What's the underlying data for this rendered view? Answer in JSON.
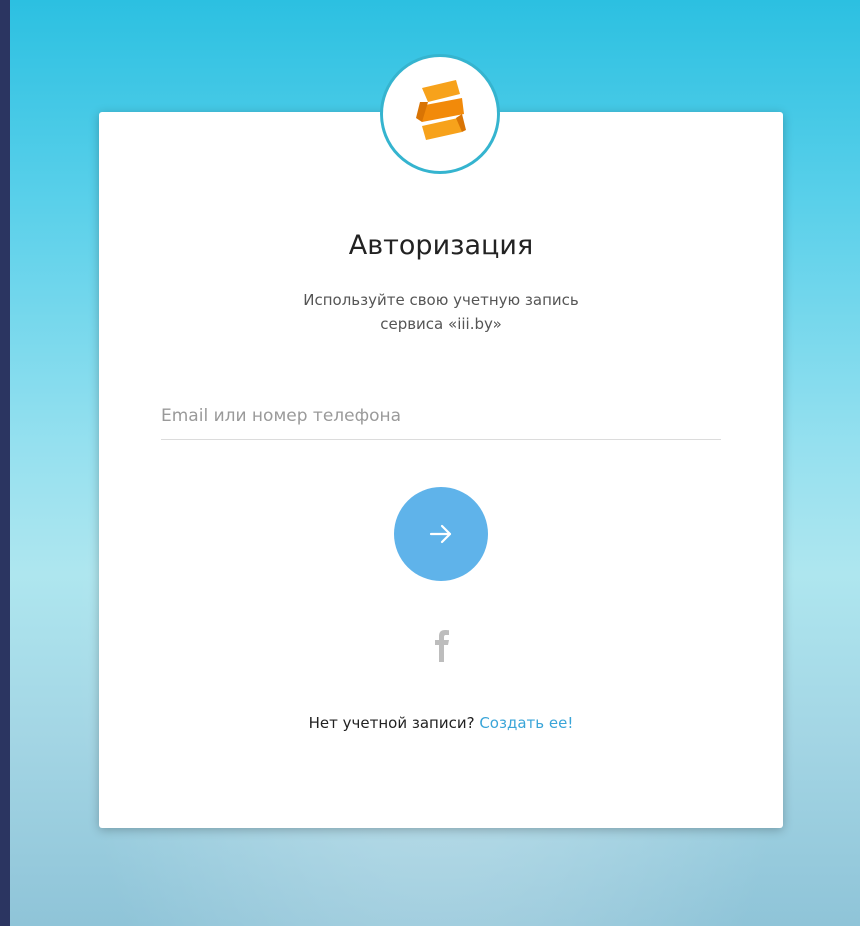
{
  "page": {
    "title": "Авторизация",
    "subtitle_line1": "Используйте свою учетную запись",
    "subtitle_line2": "сервиса «iii.by»"
  },
  "form": {
    "login_placeholder": "Email или номер телефона",
    "login_value": "",
    "submit_icon": "arrow-right-icon"
  },
  "social": {
    "facebook_icon": "facebook-icon"
  },
  "footer": {
    "no_account_text": "Нет учетной записи?",
    "create_link": "Создать ее!"
  },
  "colors": {
    "accent": "#5fb3ea",
    "link": "#3aa5d8",
    "logo_orange": "#f28a0a",
    "logo_ring": "#35b4cf"
  }
}
